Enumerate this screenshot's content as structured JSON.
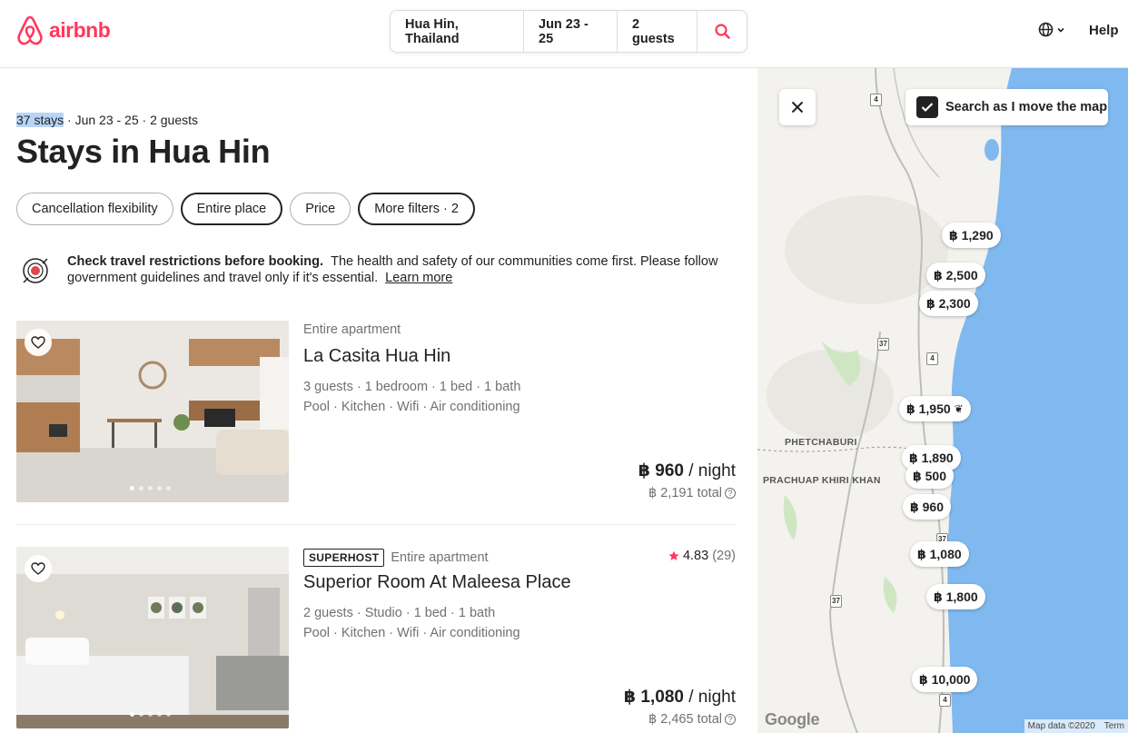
{
  "header": {
    "brand": "airbnb",
    "search": {
      "location": "Hua Hin, Thailand",
      "dates": "Jun 23 - 25",
      "guests": "2 guests"
    },
    "help_label": "Help",
    "accent_color": "#ff385c"
  },
  "results": {
    "count_text": "37 stays",
    "meta_rest": " · Jun 23 - 25 · 2 guests",
    "title": "Stays in Hua Hin"
  },
  "filters": [
    {
      "label": "Cancellation flexibility",
      "active": false
    },
    {
      "label": "Entire place",
      "active": true
    },
    {
      "label": "Price",
      "active": false
    },
    {
      "label": "More filters · 2",
      "active": true
    }
  ],
  "notice": {
    "bold": "Check travel restrictions before booking.",
    "text": "The health and safety of our communities come first. Please follow government guidelines and travel only if it's essential.",
    "link": "Learn more"
  },
  "listings": [
    {
      "type": "Entire apartment",
      "superhost": "",
      "name": "La Casita Hua Hin",
      "details": "3 guests · 1 bedroom · 1 bed · 1 bath",
      "amenities": "Pool · Kitchen · Wifi · Air conditioning",
      "rating": "",
      "reviews": "",
      "price": "฿ 960",
      "per": " / night",
      "total": "฿ 2,191 total"
    },
    {
      "type": "Entire apartment",
      "superhost": "SUPERHOST",
      "name": "Superior Room At Maleesa Place",
      "details": "2 guests · Studio · 1 bed · 1 bath",
      "amenities": "Pool · Kitchen · Wifi · Air conditioning",
      "rating": "4.83",
      "reviews": "(29)",
      "price": "฿ 1,080",
      "per": " / night",
      "total": "฿ 2,465 total"
    }
  ],
  "map": {
    "search_toggle": "Search as I move the map",
    "search_toggle_checked": true,
    "pins": [
      "฿ 1,290",
      "฿ 2,500",
      "฿ 2,300",
      "฿ 1,950",
      "฿ 1,890",
      "฿ 500",
      "฿ 960",
      "฿ 1,080",
      "฿ 1,800",
      "฿ 10,000"
    ],
    "labels": [
      "PHETCHABURI",
      "PRACHUAP KHIRI KHAN"
    ],
    "road_shields": [
      "4",
      "37",
      "4",
      "37",
      "4",
      "37",
      "4"
    ],
    "attribution": "Map data ©2020",
    "terms": "Term",
    "google": "Google"
  }
}
